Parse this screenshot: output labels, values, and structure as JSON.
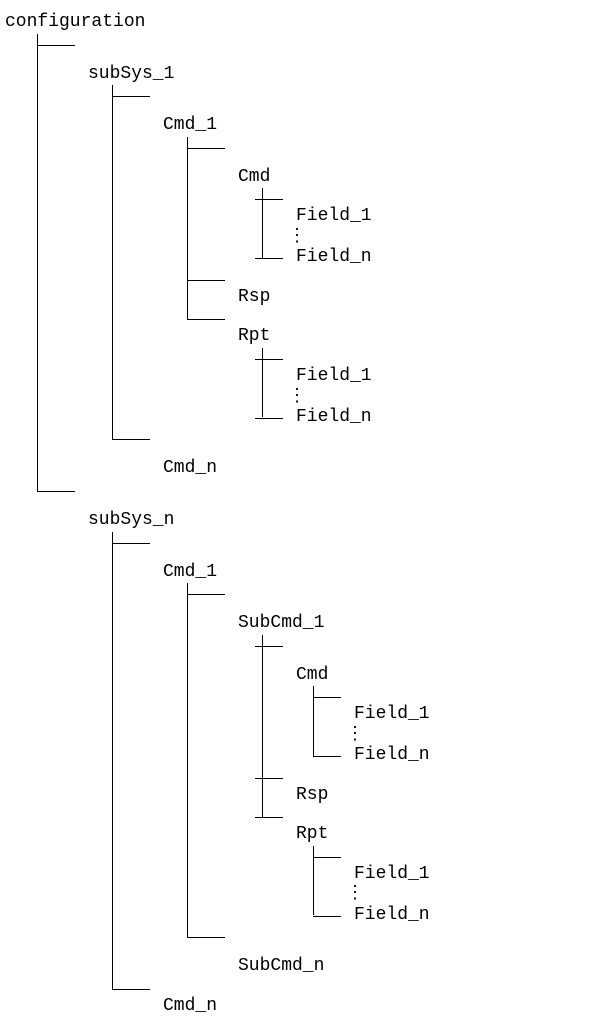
{
  "root": "configuration",
  "subsys1": "subSys_1",
  "subsysn": "subSys_n",
  "cmd1": "Cmd_1",
  "cmdn": "Cmd_n",
  "cmd": "Cmd",
  "rsp": "Rsp",
  "rpt": "Rpt",
  "field1": "Field_1",
  "fieldn": "Field_n",
  "subcmd1": "SubCmd_1",
  "subcmdn": "SubCmd_n",
  "vdots": "⋮"
}
